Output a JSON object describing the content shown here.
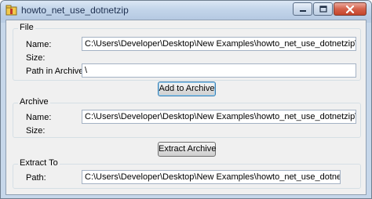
{
  "window": {
    "title": "howto_net_use_dotnetzip"
  },
  "file_group": {
    "title": "File",
    "name_label": "Name:",
    "name_value": "C:\\Users\\Developer\\Desktop\\New Examples\\howto_net_use_dotnetzip\\JackOLantern.bmp",
    "size_label": "Size:",
    "size_value": "",
    "path_label": "Path in Archive:",
    "path_value": "\\"
  },
  "add_button": {
    "label": "Add to Archive"
  },
  "archive_group": {
    "title": "Archive",
    "name_label": "Name:",
    "name_value": "C:\\Users\\Developer\\Desktop\\New Examples\\howto_net_use_dotnetzip\\JackOLantern.zip",
    "size_label": "Size:",
    "size_value": ""
  },
  "extract_button": {
    "label": "Extract Archive"
  },
  "extract_group": {
    "title": "Extract To",
    "path_label": "Path:",
    "path_value": "C:\\Users\\Developer\\Desktop\\New Examples\\howto_net_use_dotnetzip\\ExtractedFiles\\"
  },
  "icons": {
    "app": "app-icon",
    "minimize": "minimize-icon",
    "maximize": "maximize-icon",
    "close": "close-icon"
  }
}
